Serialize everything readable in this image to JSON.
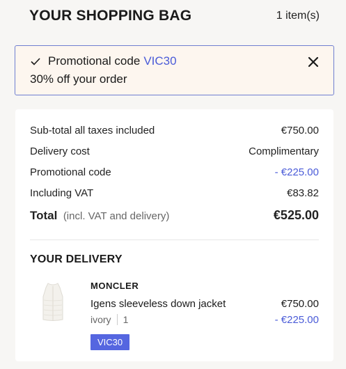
{
  "header": {
    "title": "YOUR SHOPPING BAG",
    "item_count": "1 item(s)"
  },
  "promo": {
    "label": "Promotional code",
    "code": "VIC30",
    "description": "30% off your order"
  },
  "summary": {
    "subtotal_label": "Sub-total all taxes included",
    "subtotal_value": "€750.00",
    "delivery_label": "Delivery cost",
    "delivery_value": "Complimentary",
    "promo_label": "Promotional code",
    "promo_value": "- €225.00",
    "vat_label": "Including VAT",
    "vat_value": "€83.82",
    "total_label": "Total",
    "total_note": "(incl. VAT and delivery)",
    "total_value": "€525.00"
  },
  "delivery": {
    "title": "YOUR DELIVERY",
    "item": {
      "brand": "MONCLER",
      "name": "Igens sleeveless down jacket",
      "color": "ivory",
      "quantity": "1",
      "price": "€750.00",
      "discount": "- €225.00",
      "code_badge": "VIC30"
    }
  },
  "colors": {
    "accent": "#4a5bd8",
    "badge": "#5566e0",
    "promo_border": "#6f7fd0",
    "promo_bg": "#fdf6ef"
  }
}
